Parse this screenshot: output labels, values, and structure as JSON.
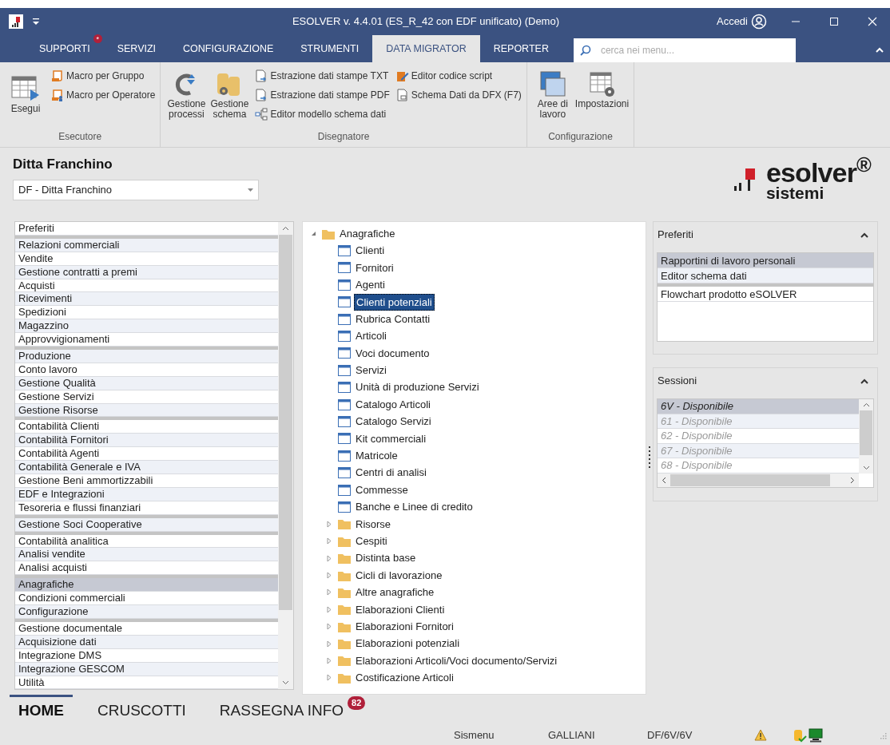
{
  "window": {
    "title": "ESOLVER v. 4.4.01 (ES_R_42 con EDF unificato)  (Demo)",
    "login": "Accedi"
  },
  "menu_tabs": [
    {
      "label": "SUPPORTI",
      "selected": false,
      "badge": "*"
    },
    {
      "label": "SERVIZI",
      "selected": false
    },
    {
      "label": "CONFIGURAZIONE",
      "selected": false
    },
    {
      "label": "STRUMENTI",
      "selected": false
    },
    {
      "label": "DATA MIGRATOR",
      "selected": true
    },
    {
      "label": "REPORTER",
      "selected": false
    }
  ],
  "search": {
    "placeholder": "cerca nei menu..."
  },
  "ribbon": [
    {
      "title": "Esecutore",
      "large": [
        {
          "label": "Esegui"
        }
      ],
      "small": [
        {
          "label": "Macro per Gruppo"
        },
        {
          "label": "Macro per Operatore"
        }
      ]
    },
    {
      "title": "Disegnatore",
      "large": [
        {
          "label": "Gestione processi"
        },
        {
          "label": "Gestione schema"
        }
      ],
      "small": [
        {
          "label": "Estrazione dati stampe TXT"
        },
        {
          "label": "Estrazione dati stampe PDF"
        },
        {
          "label": "Editor modello schema dati"
        },
        {
          "label": "Editor codice script"
        },
        {
          "label": "Schema Dati da DFX (F7)"
        }
      ]
    },
    {
      "title": "Configurazione",
      "large": [
        {
          "label": "Aree di lavoro"
        },
        {
          "label": "Impostazioni"
        }
      ]
    }
  ],
  "company": {
    "name": "Ditta Franchino",
    "selector": "DF - Ditta Franchino"
  },
  "logo": {
    "name": "esolver$^{®}$",
    "sub": "sistemi"
  },
  "menu_groups": [
    [
      {
        "label": "Preferiti",
        "selected": false
      }
    ],
    [
      {
        "label": "Relazioni commerciali",
        "selected": false
      },
      {
        "label": "Vendite",
        "selected": false
      },
      {
        "label": "Gestione contratti a premi",
        "selected": false
      },
      {
        "label": "Acquisti",
        "selected": false
      },
      {
        "label": "Ricevimenti",
        "selected": false
      },
      {
        "label": "Spedizioni",
        "selected": false
      },
      {
        "label": "Magazzino",
        "selected": false
      },
      {
        "label": "Approvvigionamenti",
        "selected": false
      }
    ],
    [
      {
        "label": "Produzione",
        "selected": false
      },
      {
        "label": "Conto lavoro",
        "selected": false
      },
      {
        "label": "Gestione Qualità",
        "selected": false
      },
      {
        "label": "Gestione Servizi",
        "selected": false
      },
      {
        "label": "Gestione Risorse",
        "selected": false
      }
    ],
    [
      {
        "label": "Contabilità Clienti",
        "selected": false
      },
      {
        "label": "Contabilità Fornitori",
        "selected": false
      },
      {
        "label": "Contabilità Agenti",
        "selected": false
      },
      {
        "label": "Contabilità Generale e IVA",
        "selected": false
      },
      {
        "label": "Gestione Beni ammortizzabili",
        "selected": false
      },
      {
        "label": "EDF e Integrazioni",
        "selected": false
      },
      {
        "label": "Tesoreria e flussi finanziari",
        "selected": false
      }
    ],
    [
      {
        "label": "Gestione Soci Cooperative",
        "selected": false
      }
    ],
    [
      {
        "label": "Contabilità analitica",
        "selected": false
      },
      {
        "label": "Analisi vendite",
        "selected": false
      },
      {
        "label": "Analisi acquisti",
        "selected": false
      }
    ],
    [
      {
        "label": "Anagrafiche",
        "selected": true
      },
      {
        "label": "Condizioni commerciali",
        "selected": false
      },
      {
        "label": "Configurazione",
        "selected": false
      }
    ],
    [
      {
        "label": "Gestione documentale",
        "selected": false
      },
      {
        "label": "Acquisizione dati",
        "selected": false
      },
      {
        "label": "Integrazione DMS",
        "selected": false
      },
      {
        "label": "Integrazione GESCOM",
        "selected": false
      },
      {
        "label": "Utilità",
        "selected": false
      }
    ]
  ],
  "tree": [
    {
      "label": "Anagrafiche",
      "kind": "folder",
      "expanded": true,
      "selected": false,
      "children": [
        {
          "label": "Clienti",
          "kind": "form",
          "selected": false
        },
        {
          "label": "Fornitori",
          "kind": "form",
          "selected": false
        },
        {
          "label": "Agenti",
          "kind": "form",
          "selected": false
        },
        {
          "label": "Clienti potenziali",
          "kind": "form",
          "selected": true
        },
        {
          "label": "Rubrica Contatti",
          "kind": "form",
          "selected": false
        },
        {
          "label": "Articoli",
          "kind": "form",
          "selected": false
        },
        {
          "label": "Voci documento",
          "kind": "form",
          "selected": false
        },
        {
          "label": "Servizi",
          "kind": "form",
          "selected": false
        },
        {
          "label": "Unità di produzione Servizi",
          "kind": "form",
          "selected": false
        },
        {
          "label": "Catalogo Articoli",
          "kind": "form",
          "selected": false
        },
        {
          "label": "Catalogo Servizi",
          "kind": "form",
          "selected": false
        },
        {
          "label": "Kit commerciali",
          "kind": "form",
          "selected": false
        },
        {
          "label": "Matricole",
          "kind": "form",
          "selected": false
        },
        {
          "label": "Centri di analisi",
          "kind": "form",
          "selected": false
        },
        {
          "label": "Commesse",
          "kind": "form",
          "selected": false
        },
        {
          "label": "Banche e Linee di credito",
          "kind": "form",
          "selected": false
        },
        {
          "label": "Risorse",
          "kind": "folder",
          "expanded": false,
          "selected": false
        },
        {
          "label": "Cespiti",
          "kind": "folder",
          "expanded": false,
          "selected": false
        },
        {
          "label": "Distinta base",
          "kind": "folder",
          "expanded": false,
          "selected": false
        },
        {
          "label": "Cicli di lavorazione",
          "kind": "folder",
          "expanded": false,
          "selected": false
        },
        {
          "label": "Altre anagrafiche",
          "kind": "folder",
          "expanded": false,
          "selected": false
        },
        {
          "label": "Elaborazioni Clienti",
          "kind": "folder",
          "expanded": false,
          "selected": false
        },
        {
          "label": "Elaborazioni Fornitori",
          "kind": "folder",
          "expanded": false,
          "selected": false
        },
        {
          "label": "Elaborazioni potenziali",
          "kind": "folder",
          "expanded": false,
          "selected": false
        },
        {
          "label": "Elaborazioni Articoli/Voci documento/Servizi",
          "kind": "folder",
          "expanded": false,
          "selected": false
        },
        {
          "label": "Costificazione Articoli",
          "kind": "folder",
          "expanded": false,
          "selected": false
        }
      ]
    }
  ],
  "favorites": {
    "title": "Preferiti",
    "groups": [
      [
        {
          "label": "Rapportini di lavoro personali",
          "selected": true
        },
        {
          "label": "Editor schema dati",
          "selected": false
        }
      ],
      [
        {
          "label": "Flowchart prodotto eSOLVER",
          "selected": false
        }
      ]
    ]
  },
  "sessions": {
    "title": "Sessioni",
    "items": [
      {
        "label": "6V - Disponibile",
        "selected": true
      },
      {
        "label": "61 - Disponibile",
        "selected": false
      },
      {
        "label": "62 - Disponibile",
        "selected": false
      },
      {
        "label": "67 - Disponibile",
        "selected": false
      },
      {
        "label": "68 - Disponibile",
        "selected": false
      }
    ]
  },
  "bottom_tabs": [
    {
      "label": "HOME",
      "selected": true
    },
    {
      "label": "CRUSCOTTI",
      "selected": false
    },
    {
      "label": "RASSEGNA INFO",
      "selected": false,
      "badge": "82"
    }
  ],
  "status_bar": [
    "Sismenu",
    "GALLIANI",
    "DF/6V/6V"
  ]
}
